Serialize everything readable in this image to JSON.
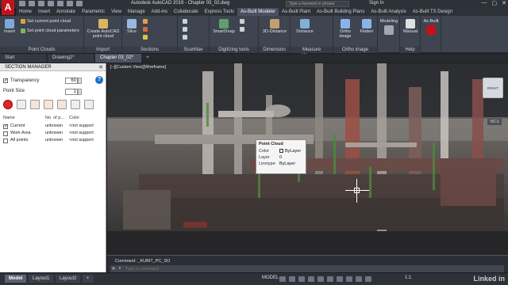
{
  "titlebar": {
    "app_letter": "A",
    "title": "Autodesk AutoCAD 2019 -  Chapter 03_02.dwg",
    "search_placeholder": "Type a keyword or phrase",
    "signin": "Sign In",
    "window_controls": [
      "—",
      "▢",
      "✕"
    ]
  },
  "ribbon_tabs": [
    "Home",
    "Insert",
    "Annotate",
    "Parametric",
    "View",
    "Manage",
    "Add-ins",
    "Collaborate",
    "Express Tools",
    "As-Built Modeler",
    "As-Built Plant",
    "As-Built Building Plans",
    "As-Built Analysis",
    "As-Built TS Design"
  ],
  "ribbon_active_tab": "As-Built Modeler",
  "ribbon": {
    "insert_label": "Insert",
    "set_current": "Set current point cloud",
    "set_params": "Set point cloud parameters",
    "group_point_clouds": "Point Clouds",
    "create_autocad": "Create AutoCAD point cloud",
    "group_import": "Import",
    "slice": "Slice",
    "group_sections": "Sections",
    "group_scannav": "ScanNav",
    "smartsnap": "SmartSnap",
    "group_digitizing": "Digitizing tools",
    "distance3d": "3D-Distance",
    "group_dimension": "Dimension",
    "distance": "Distance",
    "group_measure": "Measure differences",
    "ortho_image": "Ortho image",
    "group_ortho": "Ortho image",
    "flatten": "Flatten",
    "modeling": "Modeling",
    "manual": "Manual",
    "group_help": "Help",
    "asbuilt": "As-Built"
  },
  "doc_tabs": [
    "Start",
    "Drawing2*",
    "Chapter 03_02*"
  ],
  "doc_active": "Chapter 03_02*",
  "palette": {
    "title": "SECTION MANAGER",
    "close": "✕",
    "transparency_label": "Transparency",
    "transparency_value": "60",
    "point_size_label": "Point Size",
    "point_size_value": "1",
    "help": "?",
    "headers": [
      "Name",
      "No. of p...",
      "Color"
    ],
    "rows": [
      {
        "checked": true,
        "name": "Current",
        "points": "unknown",
        "color": "<not support"
      },
      {
        "checked": false,
        "name": "Work Area",
        "points": "unknown",
        "color": "<not support"
      },
      {
        "checked": false,
        "name": "All points",
        "points": "unknown",
        "color": "<not support"
      }
    ]
  },
  "viewport": {
    "label": "[−][Custom View][Wireframe]",
    "viewcube_face": "RIGHT",
    "wcs": "WCS"
  },
  "tooltip": {
    "title": "Point Cloud",
    "rows": [
      {
        "key": "Color",
        "value": "ByLayer"
      },
      {
        "key": "Layer",
        "value": "0"
      },
      {
        "key": "Linetype",
        "value": "ByLayer"
      }
    ]
  },
  "command": {
    "history": "Command: _KUBIT_PC_SO",
    "placeholder": "Type a command"
  },
  "status": {
    "layout_tabs": [
      "Model",
      "Layout1",
      "Layout2"
    ],
    "active_layout": "Model",
    "add": "+",
    "model": "MODEL",
    "scale": "1:1",
    "watermark": "Linked in"
  },
  "colors": {
    "accent": "#c2121b",
    "ribbon_bg": "#3e4450",
    "palette_bg": "#ffffff",
    "viewport_bg": "#2a2c31"
  }
}
